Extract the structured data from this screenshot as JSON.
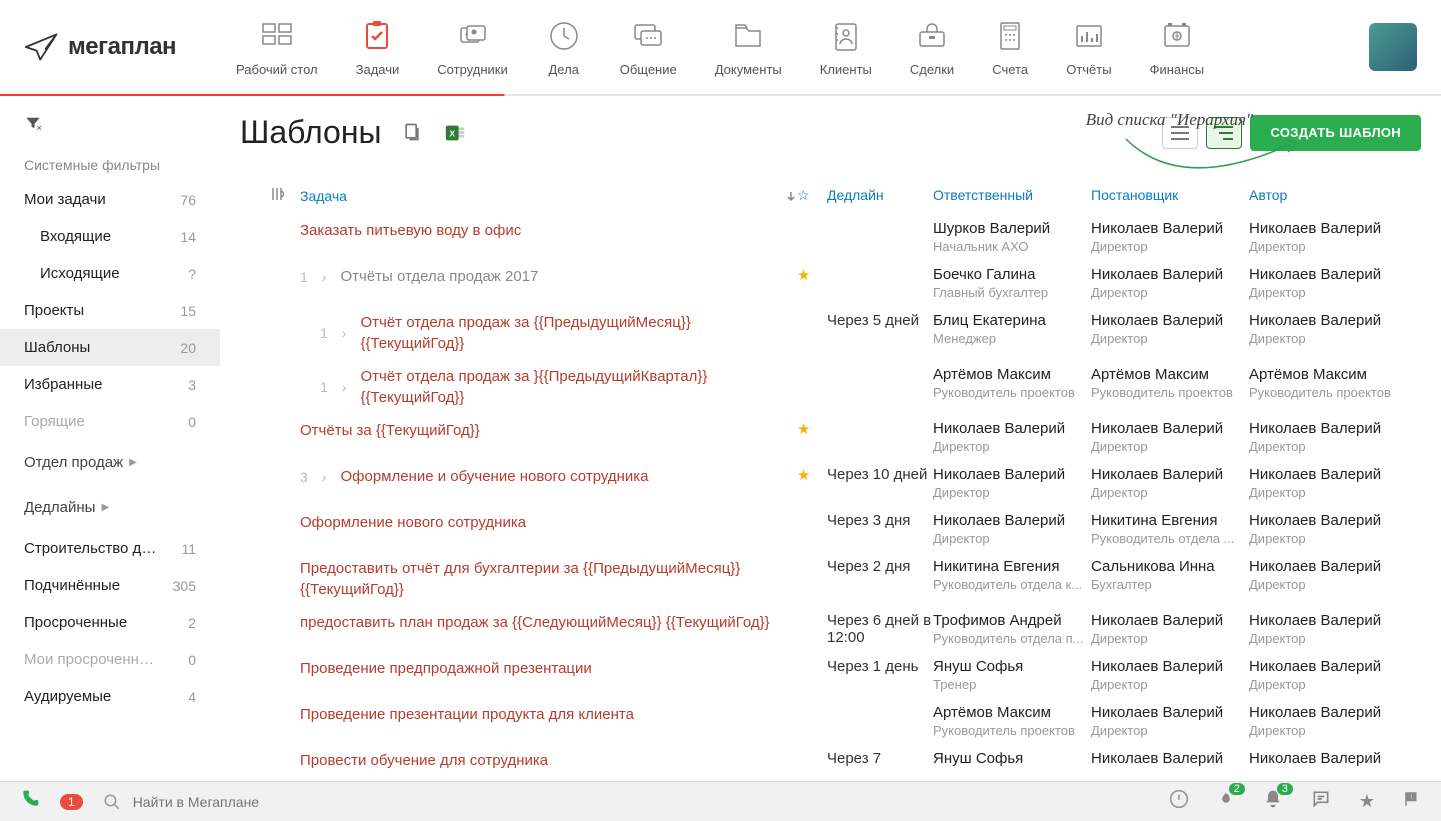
{
  "app": {
    "name": "мегаплан"
  },
  "nav": [
    {
      "label": "Рабочий стол",
      "icon": "dashboard"
    },
    {
      "label": "Задачи",
      "icon": "tasks",
      "active": true
    },
    {
      "label": "Сотрудники",
      "icon": "people"
    },
    {
      "label": "Дела",
      "icon": "clock"
    },
    {
      "label": "Общение",
      "icon": "chat"
    },
    {
      "label": "Документы",
      "icon": "docs"
    },
    {
      "label": "Клиенты",
      "icon": "clients"
    },
    {
      "label": "Сделки",
      "icon": "deals"
    },
    {
      "label": "Счета",
      "icon": "invoices"
    },
    {
      "label": "Отчёты",
      "icon": "reports"
    },
    {
      "label": "Финансы",
      "icon": "finance"
    }
  ],
  "sidebar": {
    "section_head": "Системные фильтры",
    "groups": [
      {
        "label": "Мои задачи",
        "count": "76"
      },
      {
        "label": "Входящие",
        "count": "14",
        "sub": true
      },
      {
        "label": "Исходящие",
        "count": "?",
        "sub": true
      },
      {
        "label": "Проекты",
        "count": "15"
      },
      {
        "label": "Шаблоны",
        "count": "20",
        "active": true
      },
      {
        "label": "Избранные",
        "count": "3"
      },
      {
        "label": "Горящие",
        "count": "0",
        "dim": true
      }
    ],
    "expand1": "Отдел продаж",
    "expand2": "Дедлайны",
    "more": [
      {
        "label": "Строительство детск...",
        "count": "11"
      },
      {
        "label": "Подчинённые",
        "count": "305"
      },
      {
        "label": "Просроченные",
        "count": "2"
      },
      {
        "label": "Мои просроченные за...",
        "count": "0",
        "dim": true
      },
      {
        "label": "Аудируемые",
        "count": "4"
      }
    ]
  },
  "page": {
    "title": "Шаблоны",
    "hint": "Вид списка \"Иерархия\"",
    "create_btn": "СОЗДАТЬ ШАБЛОН"
  },
  "columns": {
    "task": "Задача",
    "deadline": "Дедлайн",
    "responsible": "Ответственный",
    "owner": "Постановщик",
    "author": "Автор"
  },
  "rows": [
    {
      "indent": 0,
      "task": "Заказать питьевую воду в офис",
      "deadline": "",
      "resp": {
        "n": "Шурков Валерий",
        "r": "Начальник АХО"
      },
      "own": {
        "n": "Николаев Валерий",
        "r": "Директор"
      },
      "auth": {
        "n": "Николаев Валерий",
        "r": "Директор"
      }
    },
    {
      "indent": 0,
      "num": "1",
      "chev": true,
      "gray": true,
      "task": "Отчёты отдела продаж 2017",
      "star": true,
      "deadline": "",
      "resp": {
        "n": "Боечко Галина",
        "r": "Главный бухгалтер"
      },
      "own": {
        "n": "Николаев Валерий",
        "r": "Директор"
      },
      "auth": {
        "n": "Николаев Валерий",
        "r": "Директор"
      }
    },
    {
      "indent": 1,
      "num": "1",
      "chev": true,
      "task": "Отчёт отдела продаж за {{ПредыдущийМесяц}} {{ТекущийГод}}",
      "deadline": "Через 5 дней",
      "resp": {
        "n": "Блиц Екатерина",
        "r": "Менеджер"
      },
      "own": {
        "n": "Николаев Валерий",
        "r": "Директор"
      },
      "auth": {
        "n": "Николаев Валерий",
        "r": "Директор"
      }
    },
    {
      "indent": 1,
      "num": "1",
      "chev": true,
      "task": "Отчёт отдела продаж за }{{ПредыдущийКвартал}} {{ТекущийГод}}",
      "deadline": "",
      "resp": {
        "n": "Артёмов Максим",
        "r": "Руководитель проектов"
      },
      "own": {
        "n": "Артёмов Максим",
        "r": "Руководитель проектов"
      },
      "auth": {
        "n": "Артёмов Максим",
        "r": "Руководитель проектов"
      }
    },
    {
      "indent": 0,
      "task": "Отчёты за {{ТекущийГод}}",
      "star": true,
      "deadline": "",
      "resp": {
        "n": "Николаев Валерий",
        "r": "Директор"
      },
      "own": {
        "n": "Николаев Валерий",
        "r": "Директор"
      },
      "auth": {
        "n": "Николаев Валерий",
        "r": "Директор"
      }
    },
    {
      "indent": 0,
      "num": "3",
      "chev": true,
      "task": "Оформление и обучение нового сотрудника",
      "star": true,
      "deadline": "Через 10 дней",
      "resp": {
        "n": "Николаев Валерий",
        "r": "Директор"
      },
      "own": {
        "n": "Николаев Валерий",
        "r": "Директор"
      },
      "auth": {
        "n": "Николаев Валерий",
        "r": "Директор"
      }
    },
    {
      "indent": 0,
      "task": "Оформление нового сотрудника",
      "deadline": "Через 3 дня",
      "resp": {
        "n": "Николаев Валерий",
        "r": "Директор"
      },
      "own": {
        "n": "Никитина Евгения",
        "r": "Руководитель отдела ..."
      },
      "auth": {
        "n": "Николаев Валерий",
        "r": "Директор"
      }
    },
    {
      "indent": 0,
      "task": "Предоставить отчёт для бухгалтерии за {{ПредыдущийМесяц}} {{ТекущийГод}}",
      "deadline": "Через 2 дня",
      "resp": {
        "n": "Никитина Евгения",
        "r": "Руководитель отдела к..."
      },
      "own": {
        "n": "Сальникова Инна",
        "r": "Бухгалтер"
      },
      "auth": {
        "n": "Николаев Валерий",
        "r": "Директор"
      }
    },
    {
      "indent": 0,
      "task": "предоставить план продаж за {{СледующийМесяц}} {{ТекущийГод}}",
      "deadline": "Через 6 дней в 12:00",
      "resp": {
        "n": "Трофимов Андрей",
        "r": "Руководитель отдела п..."
      },
      "own": {
        "n": "Николаев Валерий",
        "r": "Директор"
      },
      "auth": {
        "n": "Николаев Валерий",
        "r": "Директор"
      }
    },
    {
      "indent": 0,
      "task": "Проведение предпродажной презентации",
      "deadline": "Через 1 день",
      "resp": {
        "n": "Януш Софья",
        "r": "Тренер"
      },
      "own": {
        "n": "Николаев Валерий",
        "r": "Директор"
      },
      "auth": {
        "n": "Николаев Валерий",
        "r": "Директор"
      }
    },
    {
      "indent": 0,
      "task": "Проведение презентации продукта для клиента",
      "deadline": "",
      "resp": {
        "n": "Артёмов Максим",
        "r": "Руководитель проектов"
      },
      "own": {
        "n": "Николаев Валерий",
        "r": "Директор"
      },
      "auth": {
        "n": "Николаев Валерий",
        "r": "Директор"
      }
    },
    {
      "indent": 0,
      "task": "Провести обучение для сотрудника",
      "deadline": "Через 7",
      "resp": {
        "n": "Януш Софья",
        "r": ""
      },
      "own": {
        "n": "Николаев Валерий",
        "r": ""
      },
      "auth": {
        "n": "Николаев Валерий",
        "r": ""
      }
    }
  ],
  "bottombar": {
    "phone_badge": "1",
    "search_placeholder": "Найти в Мегаплане",
    "fire_badge": "2",
    "bell_badge": "3"
  }
}
